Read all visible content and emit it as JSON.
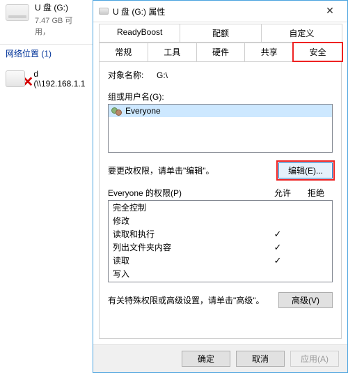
{
  "explorer": {
    "drive": {
      "label": "U 盘 (G:)",
      "sub": "7.47 GB 可用，"
    },
    "section": "网络位置 (1)",
    "share": {
      "label": "d (\\\\192.168.1.1"
    }
  },
  "dialog": {
    "title": "U 盘 (G:) 属性",
    "tabs_row1": [
      "ReadyBoost",
      "配额",
      "自定义"
    ],
    "tabs_row2": [
      "常规",
      "工具",
      "硬件",
      "共享",
      "安全"
    ],
    "active_tab": "安全",
    "object_label": "对象名称:",
    "object_value": "G:\\",
    "group_label": "组或用户名(G):",
    "principals": [
      {
        "name": "Everyone",
        "selected": true
      }
    ],
    "edit_hint": "要更改权限，请单击\"编辑\"。",
    "edit_button": "编辑(E)...",
    "perm_header": {
      "title_prefix": "Everyone 的权限(P)",
      "allow": "允许",
      "deny": "拒绝"
    },
    "permissions": [
      {
        "name": "完全控制",
        "allow": false,
        "deny": false
      },
      {
        "name": "修改",
        "allow": false,
        "deny": false
      },
      {
        "name": "读取和执行",
        "allow": true,
        "deny": false
      },
      {
        "name": "列出文件夹内容",
        "allow": true,
        "deny": false
      },
      {
        "name": "读取",
        "allow": true,
        "deny": false
      },
      {
        "name": "写入",
        "allow": false,
        "deny": false
      }
    ],
    "adv_hint": "有关特殊权限或高级设置，请单击\"高级\"。",
    "adv_button": "高级(V)",
    "footer": {
      "ok": "确定",
      "cancel": "取消",
      "apply": "应用(A)"
    }
  }
}
